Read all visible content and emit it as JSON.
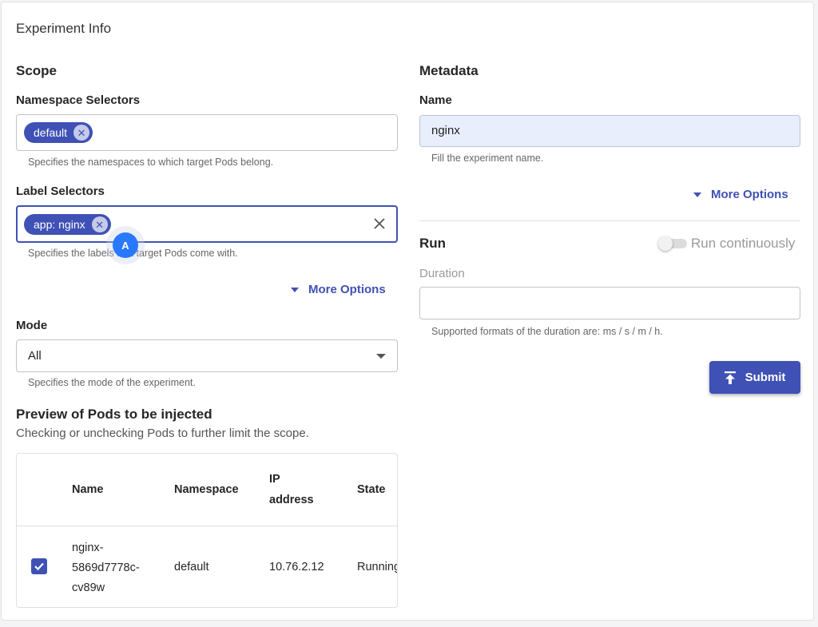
{
  "card": {
    "title": "Experiment Info"
  },
  "scope": {
    "title": "Scope",
    "namespace": {
      "label": "Namespace Selectors",
      "chips": [
        "default"
      ],
      "helper": "Specifies the namespaces to which target Pods belong."
    },
    "labels": {
      "label": "Label Selectors",
      "chips": [
        "app: nginx"
      ],
      "helper": "Specifies the labels that target Pods come with.",
      "clear_icon": "close-icon"
    },
    "more_options": "More Options",
    "mode": {
      "label": "Mode",
      "value": "All",
      "helper": "Specifies the mode of the experiment."
    },
    "preview": {
      "title": "Preview of Pods to be injected",
      "subtitle": "Checking or unchecking Pods to further limit the scope.",
      "columns": [
        "Name",
        "Namespace",
        "IP",
        "address",
        "State"
      ],
      "rows": [
        {
          "checked": true,
          "name_lines": [
            "nginx-",
            "5869d7778c-",
            "cv89w"
          ],
          "namespace": "default",
          "ip": "10.76.2.12",
          "state": "Running"
        }
      ]
    }
  },
  "metadata": {
    "title": "Metadata",
    "name": {
      "label": "Name",
      "value": "nginx",
      "helper": "Fill the experiment name."
    },
    "more_options": "More Options"
  },
  "run": {
    "title": "Run",
    "continuous_label": "Run continuously",
    "continuous_on": false,
    "duration": {
      "label": "Duration",
      "value": "",
      "helper": "Supported formats of the duration are: ms / s / m / h."
    },
    "submit_label": "Submit"
  },
  "cursor_badge": "A",
  "colors": {
    "accent": "#3f51b5",
    "badge": "#2979ff",
    "filled_input": "#e8eefc"
  }
}
